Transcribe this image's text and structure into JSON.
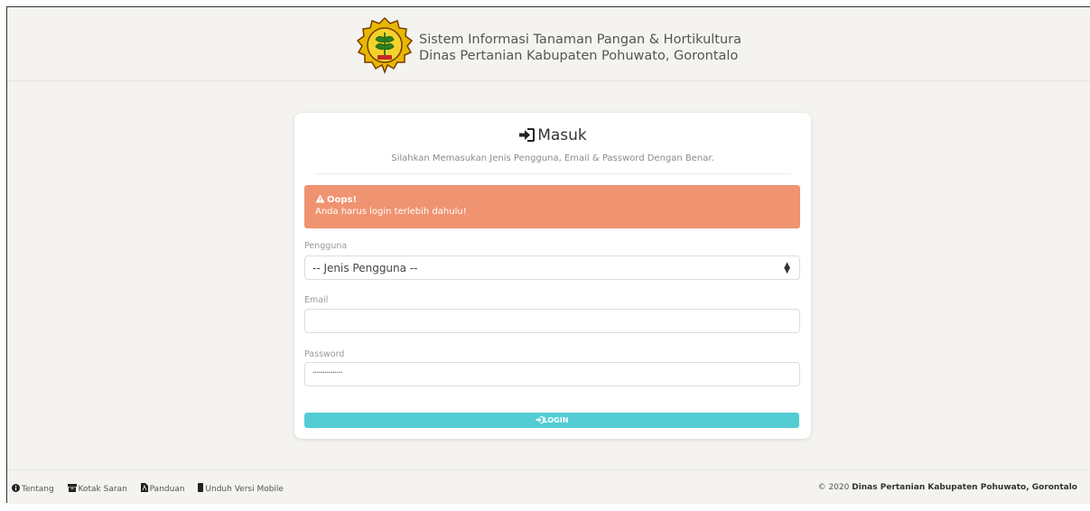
{
  "header": {
    "line1": "Sistem Informasi Tanaman Pangan & Hortikultura",
    "line2": "Dinas Pertanian Kabupaten Pohuwato, Gorontalo",
    "logo_icon": "agriculture-ministry-seal"
  },
  "card": {
    "title": "Masuk",
    "title_icon": "sign-in-icon",
    "subtitle": "Silahkan Memasukan Jenis Pengguna, Email & Password Dengan Benar."
  },
  "alert": {
    "title": "Oops!",
    "message": "Anda harus login terlebih dahulu!",
    "color": "#ef9370"
  },
  "form": {
    "user_label": "Pengguna",
    "user_select_value": "-- Jenis Pengguna --",
    "email_label": "Email",
    "email_value": "",
    "password_label": "Password",
    "password_value": "···············",
    "login_label": "LOGIN",
    "login_color": "#53cdd3"
  },
  "footer": {
    "links": [
      "Tentang",
      "Kotak Saran",
      "Panduan",
      "Unduh Versi Mobile"
    ],
    "copyright_year": "2020",
    "copyright_org": "Dinas Pertanian Kabupaten Pohuwato, Gorontalo"
  }
}
